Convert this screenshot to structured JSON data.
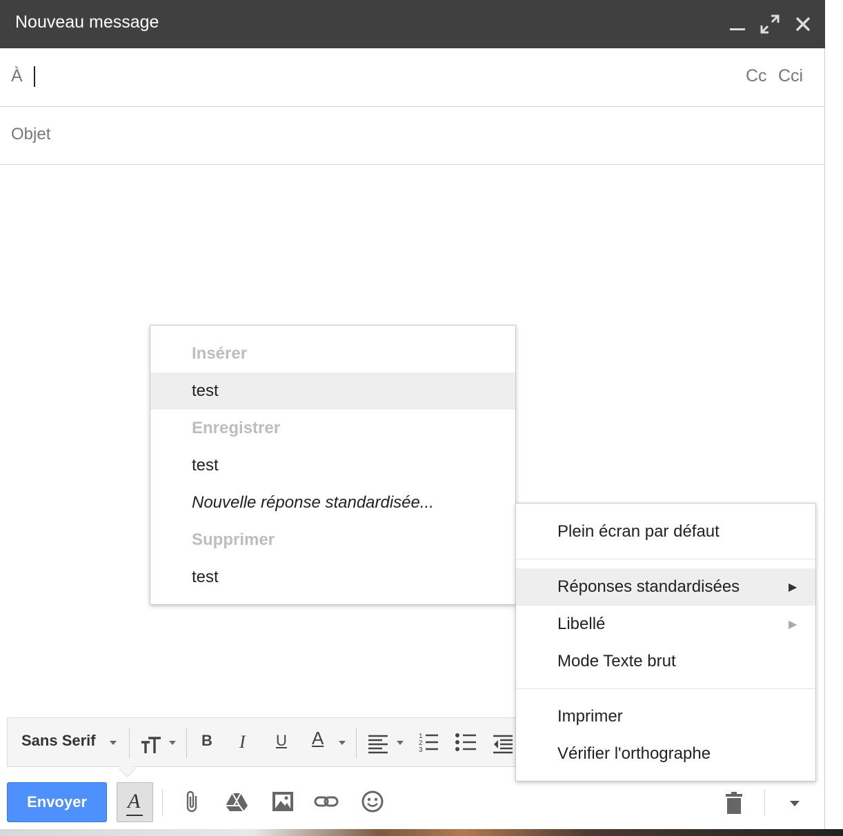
{
  "window": {
    "title": "Nouveau message"
  },
  "header_icons": [
    "minimize-icon",
    "expand-icon",
    "close-icon"
  ],
  "recipients": {
    "to_label": "À",
    "to_value": "",
    "cc_label": "Cc",
    "cci_label": "Cci"
  },
  "subject": {
    "placeholder": "Objet",
    "value": ""
  },
  "canned_menu": {
    "insert_header": "Insérer",
    "insert_items": [
      "test"
    ],
    "save_header": "Enregistrer",
    "save_items": [
      "test"
    ],
    "new_item": "Nouvelle réponse standardisée...",
    "delete_header": "Supprimer",
    "delete_items": [
      "test"
    ]
  },
  "more_menu": {
    "items": [
      "Plein écran par défaut",
      "Réponses standardisées",
      "Libellé",
      "Mode Texte brut",
      "Imprimer",
      "Vérifier l'orthographe"
    ],
    "highlighted": "Réponses standardisées"
  },
  "format_toolbar": {
    "font": "Sans Serif",
    "icons": [
      "text-size-icon",
      "bold-icon",
      "italic-icon",
      "underline-icon",
      "text-color-icon",
      "align-icon",
      "numbered-list-icon",
      "bulleted-list-icon",
      "indent-less-icon"
    ],
    "bold": "B",
    "italic": "I",
    "underline": "U",
    "text_color": "A"
  },
  "actions": {
    "send_label": "Envoyer",
    "format_toggle": "A",
    "icons": [
      "attach-icon",
      "drive-icon",
      "photo-icon",
      "link-icon",
      "emoji-icon",
      "trash-icon",
      "more-options-icon"
    ]
  },
  "colors": {
    "titlebar": "#404040",
    "send_button": "#4d90fe",
    "menu_highlight": "#eeeeee"
  }
}
